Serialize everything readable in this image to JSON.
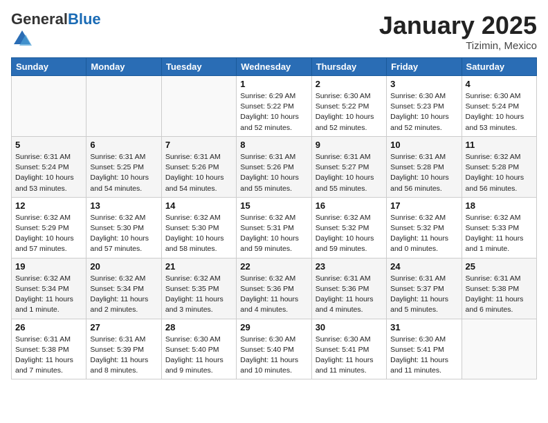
{
  "header": {
    "logo_general": "General",
    "logo_blue": "Blue",
    "month": "January 2025",
    "location": "Tizimin, Mexico"
  },
  "weekdays": [
    "Sunday",
    "Monday",
    "Tuesday",
    "Wednesday",
    "Thursday",
    "Friday",
    "Saturday"
  ],
  "weeks": [
    [
      {
        "day": "",
        "info": ""
      },
      {
        "day": "",
        "info": ""
      },
      {
        "day": "",
        "info": ""
      },
      {
        "day": "1",
        "info": "Sunrise: 6:29 AM\nSunset: 5:22 PM\nDaylight: 10 hours\nand 52 minutes."
      },
      {
        "day": "2",
        "info": "Sunrise: 6:30 AM\nSunset: 5:22 PM\nDaylight: 10 hours\nand 52 minutes."
      },
      {
        "day": "3",
        "info": "Sunrise: 6:30 AM\nSunset: 5:23 PM\nDaylight: 10 hours\nand 52 minutes."
      },
      {
        "day": "4",
        "info": "Sunrise: 6:30 AM\nSunset: 5:24 PM\nDaylight: 10 hours\nand 53 minutes."
      }
    ],
    [
      {
        "day": "5",
        "info": "Sunrise: 6:31 AM\nSunset: 5:24 PM\nDaylight: 10 hours\nand 53 minutes."
      },
      {
        "day": "6",
        "info": "Sunrise: 6:31 AM\nSunset: 5:25 PM\nDaylight: 10 hours\nand 54 minutes."
      },
      {
        "day": "7",
        "info": "Sunrise: 6:31 AM\nSunset: 5:26 PM\nDaylight: 10 hours\nand 54 minutes."
      },
      {
        "day": "8",
        "info": "Sunrise: 6:31 AM\nSunset: 5:26 PM\nDaylight: 10 hours\nand 55 minutes."
      },
      {
        "day": "9",
        "info": "Sunrise: 6:31 AM\nSunset: 5:27 PM\nDaylight: 10 hours\nand 55 minutes."
      },
      {
        "day": "10",
        "info": "Sunrise: 6:31 AM\nSunset: 5:28 PM\nDaylight: 10 hours\nand 56 minutes."
      },
      {
        "day": "11",
        "info": "Sunrise: 6:32 AM\nSunset: 5:28 PM\nDaylight: 10 hours\nand 56 minutes."
      }
    ],
    [
      {
        "day": "12",
        "info": "Sunrise: 6:32 AM\nSunset: 5:29 PM\nDaylight: 10 hours\nand 57 minutes."
      },
      {
        "day": "13",
        "info": "Sunrise: 6:32 AM\nSunset: 5:30 PM\nDaylight: 10 hours\nand 57 minutes."
      },
      {
        "day": "14",
        "info": "Sunrise: 6:32 AM\nSunset: 5:30 PM\nDaylight: 10 hours\nand 58 minutes."
      },
      {
        "day": "15",
        "info": "Sunrise: 6:32 AM\nSunset: 5:31 PM\nDaylight: 10 hours\nand 59 minutes."
      },
      {
        "day": "16",
        "info": "Sunrise: 6:32 AM\nSunset: 5:32 PM\nDaylight: 10 hours\nand 59 minutes."
      },
      {
        "day": "17",
        "info": "Sunrise: 6:32 AM\nSunset: 5:32 PM\nDaylight: 11 hours\nand 0 minutes."
      },
      {
        "day": "18",
        "info": "Sunrise: 6:32 AM\nSunset: 5:33 PM\nDaylight: 11 hours\nand 1 minute."
      }
    ],
    [
      {
        "day": "19",
        "info": "Sunrise: 6:32 AM\nSunset: 5:34 PM\nDaylight: 11 hours\nand 1 minute."
      },
      {
        "day": "20",
        "info": "Sunrise: 6:32 AM\nSunset: 5:34 PM\nDaylight: 11 hours\nand 2 minutes."
      },
      {
        "day": "21",
        "info": "Sunrise: 6:32 AM\nSunset: 5:35 PM\nDaylight: 11 hours\nand 3 minutes."
      },
      {
        "day": "22",
        "info": "Sunrise: 6:32 AM\nSunset: 5:36 PM\nDaylight: 11 hours\nand 4 minutes."
      },
      {
        "day": "23",
        "info": "Sunrise: 6:31 AM\nSunset: 5:36 PM\nDaylight: 11 hours\nand 4 minutes."
      },
      {
        "day": "24",
        "info": "Sunrise: 6:31 AM\nSunset: 5:37 PM\nDaylight: 11 hours\nand 5 minutes."
      },
      {
        "day": "25",
        "info": "Sunrise: 6:31 AM\nSunset: 5:38 PM\nDaylight: 11 hours\nand 6 minutes."
      }
    ],
    [
      {
        "day": "26",
        "info": "Sunrise: 6:31 AM\nSunset: 5:38 PM\nDaylight: 11 hours\nand 7 minutes."
      },
      {
        "day": "27",
        "info": "Sunrise: 6:31 AM\nSunset: 5:39 PM\nDaylight: 11 hours\nand 8 minutes."
      },
      {
        "day": "28",
        "info": "Sunrise: 6:30 AM\nSunset: 5:40 PM\nDaylight: 11 hours\nand 9 minutes."
      },
      {
        "day": "29",
        "info": "Sunrise: 6:30 AM\nSunset: 5:40 PM\nDaylight: 11 hours\nand 10 minutes."
      },
      {
        "day": "30",
        "info": "Sunrise: 6:30 AM\nSunset: 5:41 PM\nDaylight: 11 hours\nand 11 minutes."
      },
      {
        "day": "31",
        "info": "Sunrise: 6:30 AM\nSunset: 5:41 PM\nDaylight: 11 hours\nand 11 minutes."
      },
      {
        "day": "",
        "info": ""
      }
    ]
  ]
}
